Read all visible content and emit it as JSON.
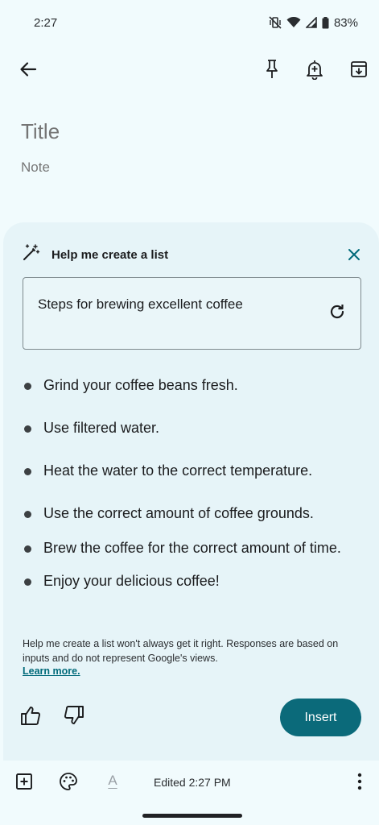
{
  "status_bar": {
    "time": "2:27",
    "battery_percent": "83%",
    "icons": [
      "vibrate-off-icon",
      "wifi-icon",
      "signal-icon",
      "battery-icon"
    ]
  },
  "top_bar": {
    "icons": [
      "back-arrow-icon",
      "pin-icon",
      "reminder-bell-icon",
      "archive-icon"
    ]
  },
  "note": {
    "title_placeholder": "Title",
    "body_placeholder": "Note"
  },
  "help_sheet": {
    "heading": "Help me create a list",
    "prompt": "Steps for brewing excellent coffee",
    "items": [
      "Grind your coffee beans fresh.",
      "Use filtered water.",
      "Heat the water to the correct temperature.",
      "Use the correct amount of coffee grounds.",
      "Brew the coffee for the correct amount of time.",
      "Enjoy your delicious coffee!"
    ],
    "disclaimer": "Help me create a list won't always get it right. Responses are based on inputs and do not represent Google's views.",
    "learn_more": "Learn more.",
    "insert_label": "Insert"
  },
  "bottom_bar": {
    "edited": "Edited 2:27 PM",
    "text_format_letter": "A"
  },
  "colors": {
    "background": "#f1fbfd",
    "sheet": "#e6f4f8",
    "accent": "#0b6a7a",
    "link": "#006a7a"
  }
}
